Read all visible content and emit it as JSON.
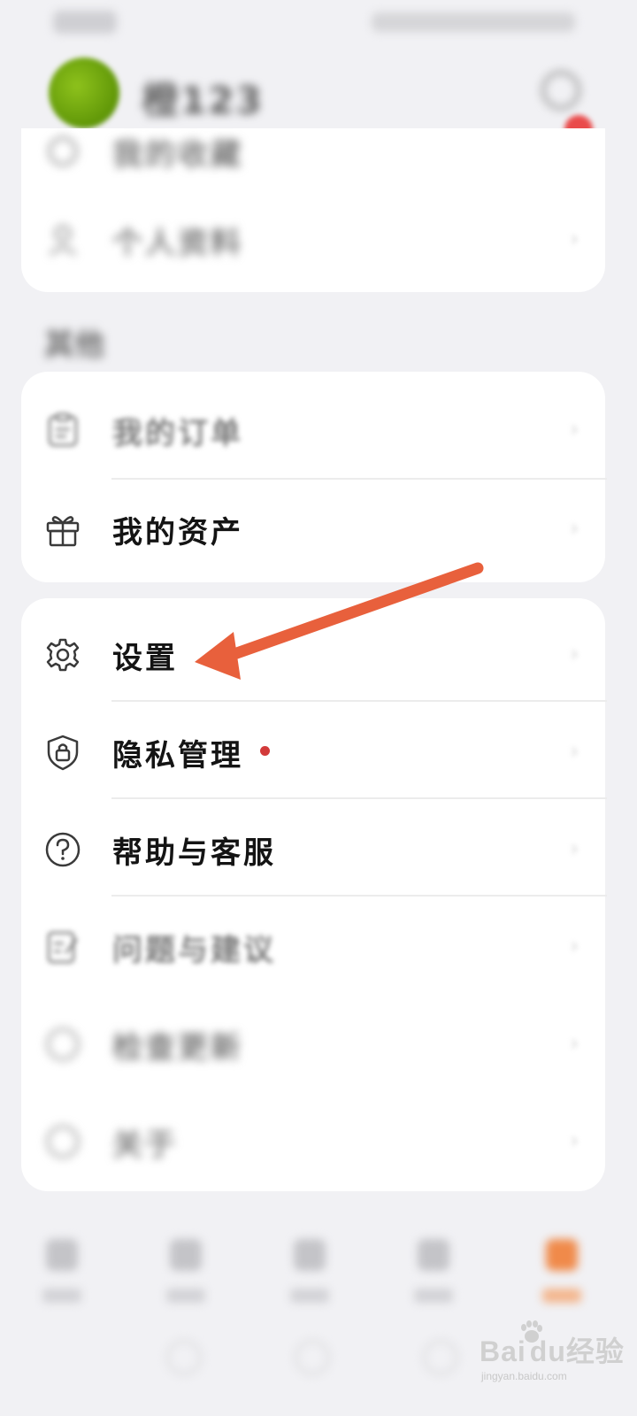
{
  "header": {
    "username": "橙123",
    "has_notification": true
  },
  "top_card": {
    "items": [
      {
        "label": "我的收藏",
        "icon": "star-icon"
      },
      {
        "label": "个人资料",
        "icon": "person-icon"
      }
    ]
  },
  "section": {
    "title": "其他"
  },
  "services": {
    "items": [
      {
        "label": "我的订单",
        "icon": "clipboard-icon"
      },
      {
        "label": "我的资产",
        "icon": "gift-icon"
      }
    ]
  },
  "settings_list": {
    "items": [
      {
        "label": "设置",
        "icon": "gear-icon"
      },
      {
        "label": "隐私管理",
        "icon": "shield-lock-icon",
        "red_dot": true
      },
      {
        "label": "帮助与客服",
        "icon": "question-icon"
      },
      {
        "label": "问题与建议",
        "icon": "edit-note-icon"
      },
      {
        "label": "检查更新",
        "icon": "refresh-icon"
      },
      {
        "label": "关于",
        "icon": "info-icon"
      }
    ]
  },
  "annotation": {
    "arrow_color": "#e8603c",
    "points_to": "设置"
  },
  "bottom_nav": {
    "active_index": 4,
    "accent": "#f08a4a"
  },
  "watermark": {
    "brand": "Bai",
    "brand_suffix": "du",
    "product": "经验",
    "url": "jingyan.baidu.com"
  }
}
